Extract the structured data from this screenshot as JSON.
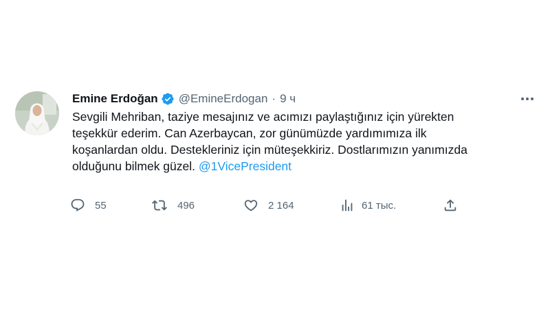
{
  "tweet": {
    "author_name": "Emine Erdoğan",
    "handle": "@EmineErdogan",
    "separator": "·",
    "time": "9 ч",
    "text_lines": [
      "Sevgili Mehriban, taziye mesajınız ve acımızı paylaştığınız için yürekten",
      "teşekkür ederim. Can Azerbaycan, zor günümüzde yardımımıza ilk",
      "koşanlardan oldu. Destekleriniz için müteşekkiriz. Dostlarımızın yanımızda",
      "olduğunu bilmek güzel. "
    ],
    "mention": "@1VicePresident"
  },
  "actions": {
    "replies": "55",
    "retweets": "496",
    "likes": "2 164",
    "views": "61 тыс."
  },
  "icons": {
    "verified": "verified-badge-icon",
    "more": "more-options-icon",
    "reply": "reply-icon",
    "retweet": "retweet-icon",
    "like": "heart-icon",
    "views": "views-chart-icon",
    "share": "share-icon"
  },
  "colors": {
    "accent": "#1d9bf0",
    "secondary_text": "#536471",
    "primary_text": "#0f1419"
  }
}
